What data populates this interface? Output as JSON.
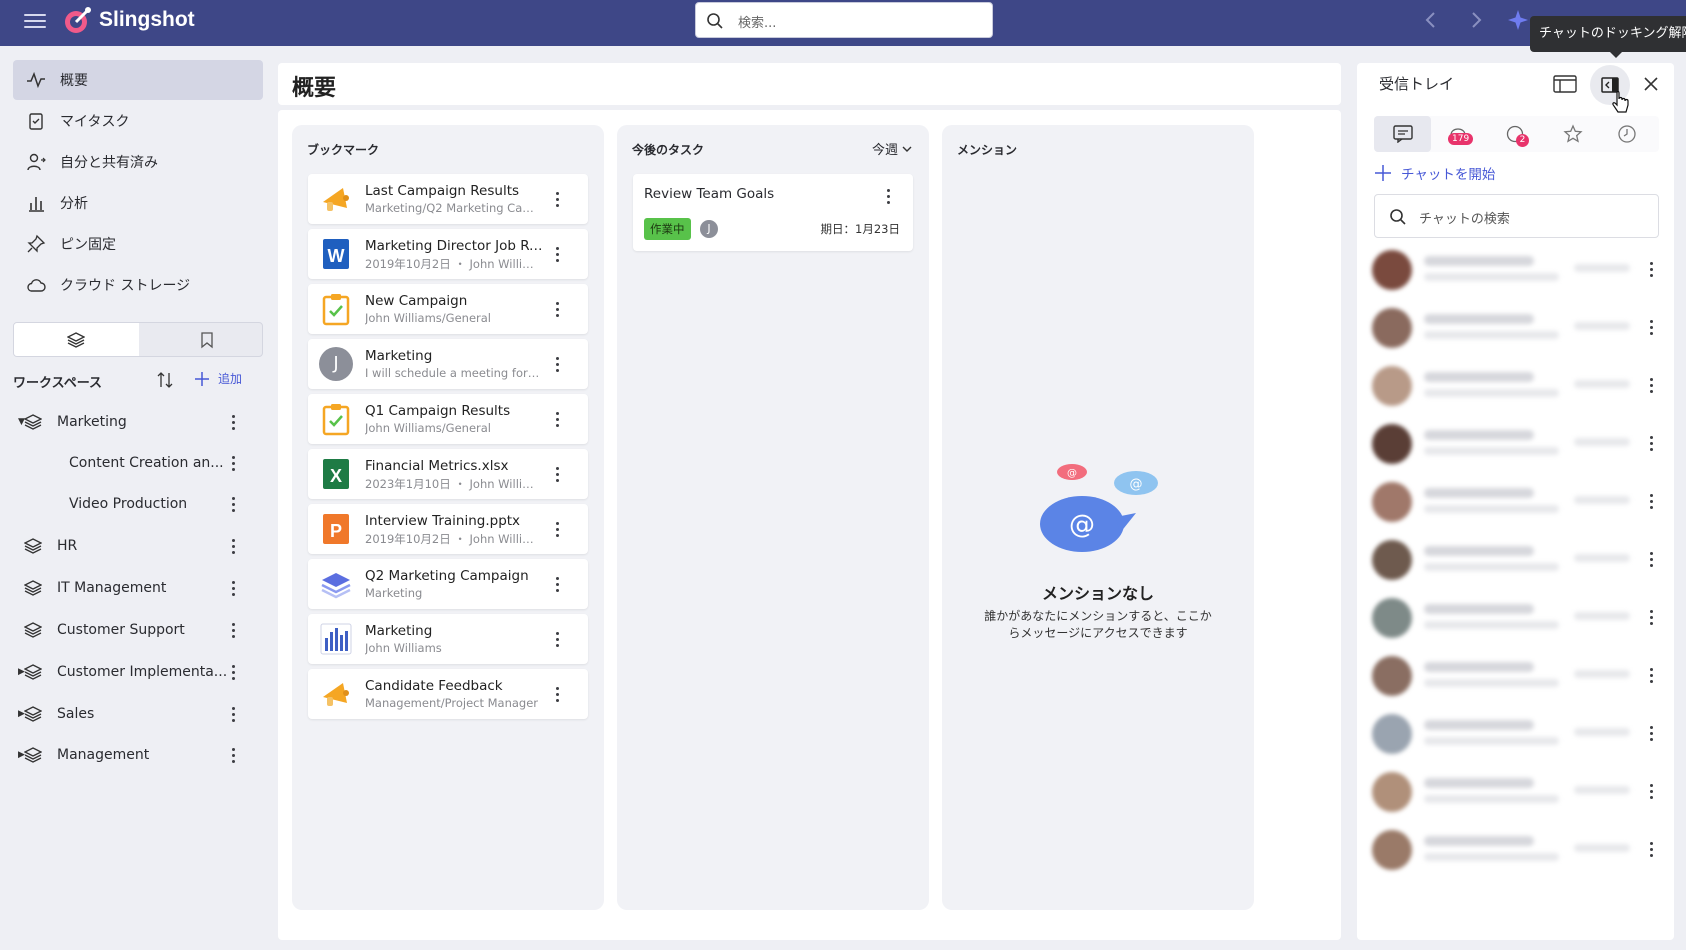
{
  "app": {
    "brand": "Slingshot"
  },
  "search": {
    "placeholder": "検索..."
  },
  "tooltip": "チャットのドッキング解除",
  "sidebar": {
    "items": [
      {
        "label": "概要",
        "icon": "activity-icon",
        "active": true
      },
      {
        "label": "マイタスク",
        "icon": "clipboard-check-icon"
      },
      {
        "label": "自分と共有済み",
        "icon": "user-share-icon"
      },
      {
        "label": "分析",
        "icon": "bar-chart-icon"
      },
      {
        "label": "ピン固定",
        "icon": "pin-icon"
      },
      {
        "label": "クラウド ストレージ",
        "icon": "cloud-icon"
      }
    ],
    "workspace_header": "ワークスペース",
    "add_label": "追加",
    "workspaces": [
      {
        "label": "Marketing",
        "expanded": true
      },
      {
        "label": "Content Creation an...",
        "child": true
      },
      {
        "label": "Video Production",
        "child": true
      },
      {
        "label": "HR"
      },
      {
        "label": "IT Management"
      },
      {
        "label": "Customer Support"
      },
      {
        "label": "Customer Implementa...",
        "collapsed": true
      },
      {
        "label": "Sales",
        "collapsed": true
      },
      {
        "label": "Management",
        "collapsed": true
      }
    ]
  },
  "main": {
    "title": "概要",
    "bookmarks": {
      "title": "ブックマーク",
      "items": [
        {
          "title": "Last Campaign Results",
          "sub": "Marketing/Q2 Marketing Cam...",
          "icon": "megaphone-icon"
        },
        {
          "title": "Marketing Director Job Ro...",
          "sub": "2019年10月2日 ・ John Willia...",
          "icon": "word-file-icon"
        },
        {
          "title": "New Campaign",
          "sub": "John Williams/General",
          "icon": "task-clipboard-icon"
        },
        {
          "title": "Marketing",
          "sub": "I will schedule a meeting for to...",
          "icon": "user-avatar-icon",
          "avatar_letter": "J"
        },
        {
          "title": "Q1 Campaign Results",
          "sub": "John Williams/General",
          "icon": "task-clipboard-icon"
        },
        {
          "title": "Financial Metrics.xlsx",
          "sub": "2023年1月10日 ・ John Willia...",
          "icon": "excel-file-icon"
        },
        {
          "title": "Interview Training.pptx",
          "sub": "2019年10月2日 ・ John Willia...",
          "icon": "powerpoint-file-icon"
        },
        {
          "title": "Q2 Marketing Campaign",
          "sub": "Marketing",
          "icon": "workspace-layers-icon"
        },
        {
          "title": "Marketing",
          "sub": "John Williams",
          "icon": "dashboard-chart-icon"
        },
        {
          "title": "Candidate Feedback",
          "sub": "Management/Project Manager",
          "icon": "megaphone-icon"
        }
      ]
    },
    "tasks": {
      "title": "今後のタスク",
      "filter": "今週",
      "items": [
        {
          "title": "Review Team Goals",
          "status": "作業中",
          "assignee": "J",
          "due": "期日：1月23日"
        }
      ]
    },
    "mentions": {
      "title": "メンション",
      "empty_title": "メンションなし",
      "empty_desc_line1": "誰かがあなたにメンションすると、ここか",
      "empty_desc_line2": "らメッセージにアクセスできます"
    }
  },
  "inbox": {
    "title": "受信トレイ",
    "badges": {
      "mentions": "179",
      "reactions": "2"
    },
    "start_chat": "チャットを開始",
    "search_placeholder": "チャットの検索",
    "chat_avatar_colors": [
      "#7a4a3e",
      "#8a6a5e",
      "#b89a88",
      "#5a3e36",
      "#a0786a",
      "#6e5a4e",
      "#7e8a88",
      "#8a6e62",
      "#9aa4b0",
      "#b0907a",
      "#9a7a68"
    ]
  },
  "colors": {
    "topbar": "#3e4787",
    "accent": "#4758d6",
    "status_green": "#58c24a"
  }
}
